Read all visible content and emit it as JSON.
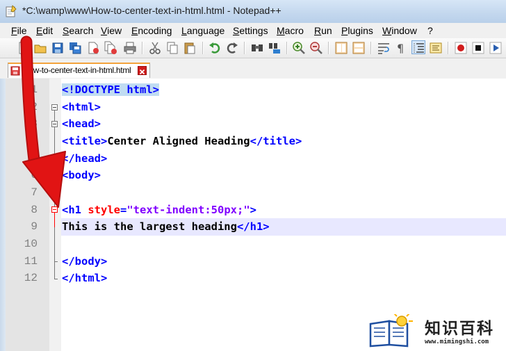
{
  "window": {
    "title": "*C:\\wamp\\www\\How-to-center-text-in-html.html - Notepad++"
  },
  "menu": [
    "File",
    "Edit",
    "Search",
    "View",
    "Encoding",
    "Language",
    "Settings",
    "Macro",
    "Run",
    "Plugins",
    "Window",
    "?"
  ],
  "toolbar": {
    "icons": [
      "new-file-icon",
      "open-file-icon",
      "save-icon",
      "save-all-icon",
      "close-icon",
      "close-all-icon",
      "print-icon",
      "cut-icon",
      "copy-icon",
      "paste-icon",
      "undo-icon",
      "redo-icon",
      "find-icon",
      "replace-icon",
      "zoom-in-icon",
      "zoom-out-icon",
      "sync-vertical-icon",
      "sync-horizontal-icon",
      "word-wrap-icon",
      "show-all-chars-icon",
      "indent-guide-icon",
      "function-list-icon",
      "record-macro-icon",
      "stop-record-icon",
      "play-macro-icon"
    ]
  },
  "tab": {
    "label": "How-to-center-text-in-html.html"
  },
  "editor": {
    "line_numbers": [
      "1",
      "2",
      "3",
      "4",
      "5",
      "6",
      "7",
      "8",
      "9",
      "10",
      "11",
      "12"
    ],
    "lines": {
      "l1": {
        "tag": "<!DOCTYPE html>"
      },
      "l2": {
        "tag": "<html>"
      },
      "l3": {
        "tag": "<head>"
      },
      "l4": {
        "open": "<title>",
        "text": "Center Aligned Heading",
        "close": "</title>"
      },
      "l5": {
        "tag": "</head>"
      },
      "l6": {
        "tag": "<body>"
      },
      "l8": {
        "open": "<h1 ",
        "attr": "style",
        "eq": "=",
        "val": "\"text-indent:50px;\"",
        "close": ">"
      },
      "l9": {
        "text": "This is the largest heading",
        "close": "</h1>"
      },
      "l11": {
        "tag": "</body>"
      },
      "l12": {
        "tag": "</html>"
      }
    },
    "current_line": 9
  },
  "colors": {
    "tag": "#0000ff",
    "attribute": "#ff0000",
    "value": "#8000ff",
    "arrow": "#e11414"
  },
  "watermark": {
    "title": "知识百科",
    "url": "www.mimingshi.com"
  }
}
